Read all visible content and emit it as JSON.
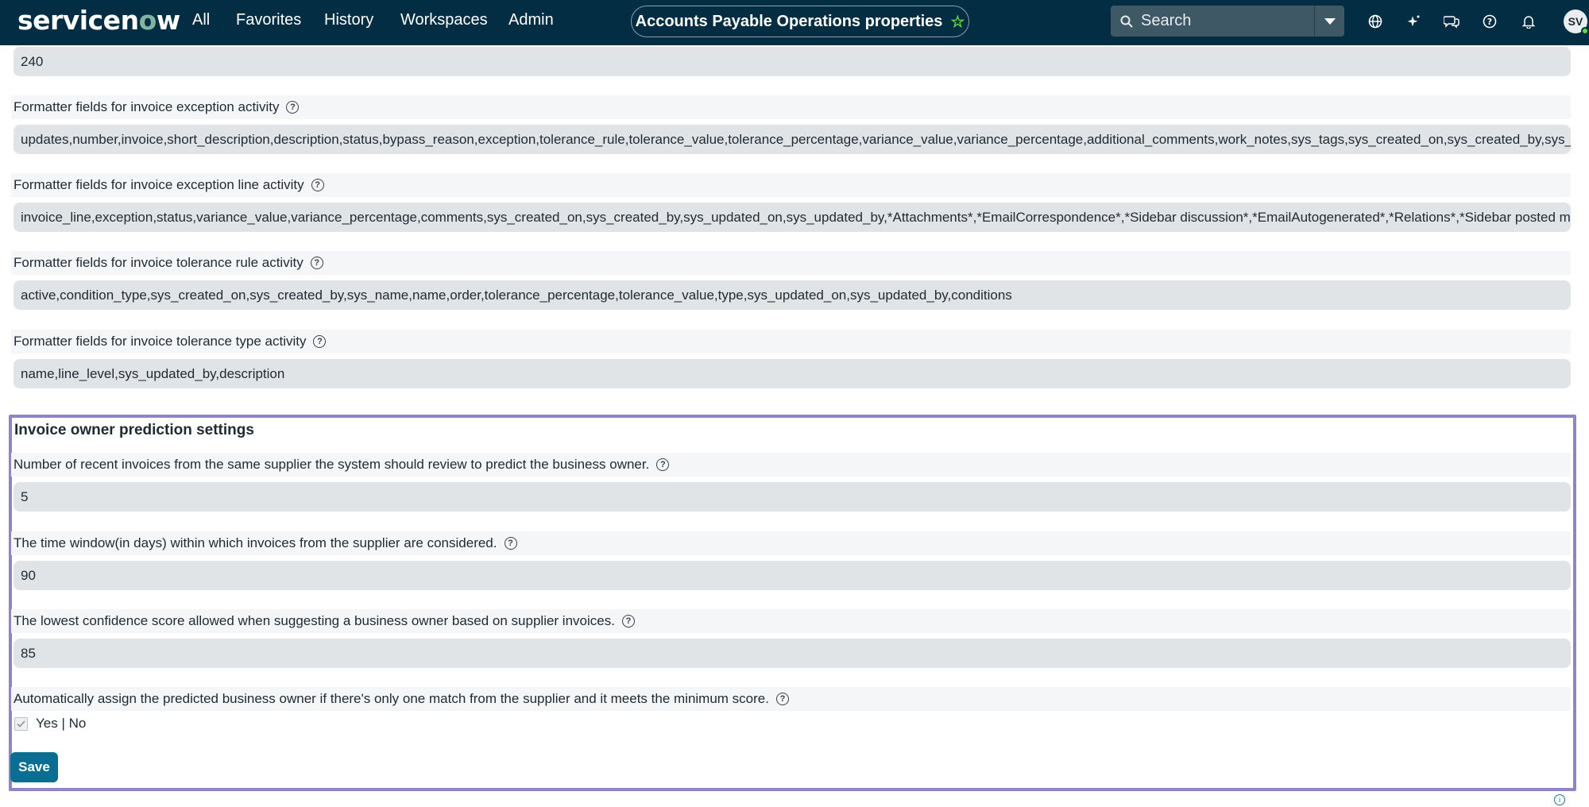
{
  "nav": {
    "logo_text_pre": "servicen",
    "logo_text_o": "o",
    "logo_text_post": "w",
    "items": [
      "All",
      "Favorites",
      "History",
      "Workspaces",
      "Admin"
    ],
    "page_title": "Accounts Payable Operations properties",
    "search_placeholder": "Search",
    "avatar_initials": "SV"
  },
  "properties": {
    "top_value": "240",
    "exception_label": "Formatter fields for invoice exception activity",
    "exception_value": "updates,number,invoice,short_description,description,status,bypass_reason,exception,tolerance_rule,tolerance_value,tolerance_percentage,variance_value,variance_percentage,additional_comments,work_notes,sys_tags,sys_created_on,sys_created_by,sys_updated_o",
    "exception_line_label": "Formatter fields for invoice exception line activity",
    "exception_line_value": "invoice_line,exception,status,variance_value,variance_percentage,comments,sys_created_on,sys_created_by,sys_updated_on,sys_updated_by,*Attachments*,*EmailCorrespondence*,*Sidebar discussion*,*EmailAutogenerated*,*Relations*,*Sidebar posted message*",
    "tolerance_rule_label": "Formatter fields for invoice tolerance rule activity",
    "tolerance_rule_value": "active,condition_type,sys_created_on,sys_created_by,sys_name,name,order,tolerance_percentage,tolerance_value,type,sys_updated_on,sys_updated_by,conditions",
    "tolerance_type_label": "Formatter fields for invoice tolerance type activity",
    "tolerance_type_value": "name,line_level,sys_updated_by,description"
  },
  "prediction": {
    "title": "Invoice owner prediction settings",
    "recent_label": "Number of recent invoices from the same supplier the system should review to predict the business owner.",
    "recent_value": "5",
    "window_label": "The time window(in days) within which invoices from the supplier are considered.",
    "window_value": "90",
    "confidence_label": "The lowest confidence score allowed when suggesting a business owner based on supplier invoices.",
    "confidence_value": "85",
    "auto_assign_label": "Automatically assign the predicted business owner if there's only one match from the supplier and it meets the minimum score.",
    "auto_assign_option": "Yes | No",
    "save_label": "Save"
  },
  "colors": {
    "topbar": "#032d42",
    "accent_green": "#62d84e",
    "save_button": "#0a6e92",
    "highlight_border": "#8e85c9"
  }
}
